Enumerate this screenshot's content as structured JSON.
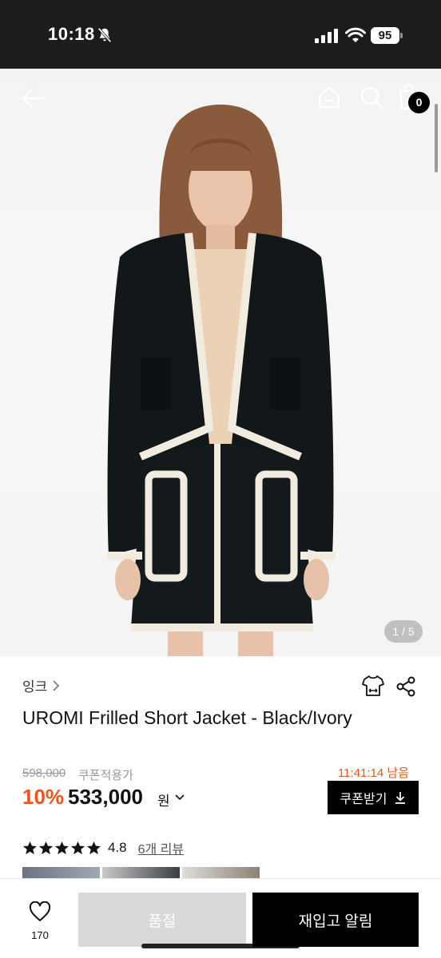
{
  "status_bar": {
    "time": "10:18",
    "battery": "95"
  },
  "header": {
    "cart_count": "0"
  },
  "gallery": {
    "counter": "1 / 5"
  },
  "product": {
    "brand": "잉크",
    "title": "UROMI Frilled Short Jacket - Black/Ivory",
    "original_price": "598,000",
    "coupon_price_label": "쿠폰적용가",
    "timer": "11:41:14 남음",
    "discount": "10%",
    "sale_price": "533,000",
    "currency": "원",
    "coupon_button": "쿠폰받기",
    "rating": "4.8",
    "stars": 5,
    "review_link": "6개 리뷰"
  },
  "bottom_bar": {
    "wish_count": "170",
    "soldout_button": "품절",
    "restock_button": "재입고 알림"
  },
  "colors": {
    "accent_discount": "#f0541e",
    "timer": "#e05a14",
    "primary_button": "#000000",
    "disabled_button": "#d9d9d9"
  },
  "icons": [
    "bell-slash-icon",
    "signal-icon",
    "wifi-icon",
    "battery-icon",
    "back-arrow-icon",
    "home-icon",
    "search-icon",
    "shopping-bag-icon",
    "chevron-right-icon",
    "size-guide-icon",
    "share-icon",
    "chevron-down-icon",
    "download-icon",
    "star-icon",
    "heart-icon"
  ]
}
